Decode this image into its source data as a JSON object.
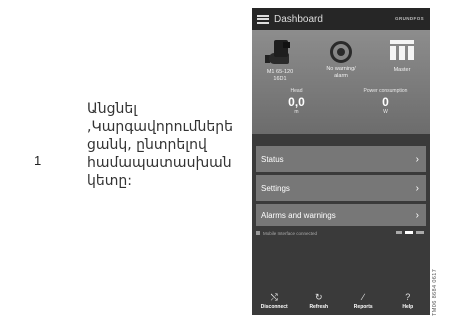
{
  "step": {
    "number": "1",
    "instruction": "Անցնել\n,Կարգավորումներե\nցանկ, ընտրելով\nհամապատասխան\nկետը:"
  },
  "app": {
    "header_title": "Dashboard",
    "brand": "GRUNDFOS"
  },
  "status": {
    "pump_label": "M1 65-120\n16D1",
    "warning_label": "No warning/\nalarm",
    "role_label": "Master",
    "head": {
      "label": "Head",
      "value": "0,0",
      "unit": "m"
    },
    "power": {
      "label": "Power consumption",
      "value": "0",
      "unit": "W"
    }
  },
  "menu": [
    {
      "label": "Status"
    },
    {
      "label": "Settings"
    },
    {
      "label": "Alarms and warnings"
    }
  ],
  "mobile_status_text": "Mobile Interface connected",
  "footer": [
    {
      "label": "Disconnect",
      "icon": "disconnect-icon"
    },
    {
      "label": "Refresh",
      "icon": "refresh-icon"
    },
    {
      "label": "Reports",
      "icon": "reports-icon"
    },
    {
      "label": "Help",
      "icon": "help-icon"
    }
  ],
  "figure_code": "TM06 8684 0617"
}
